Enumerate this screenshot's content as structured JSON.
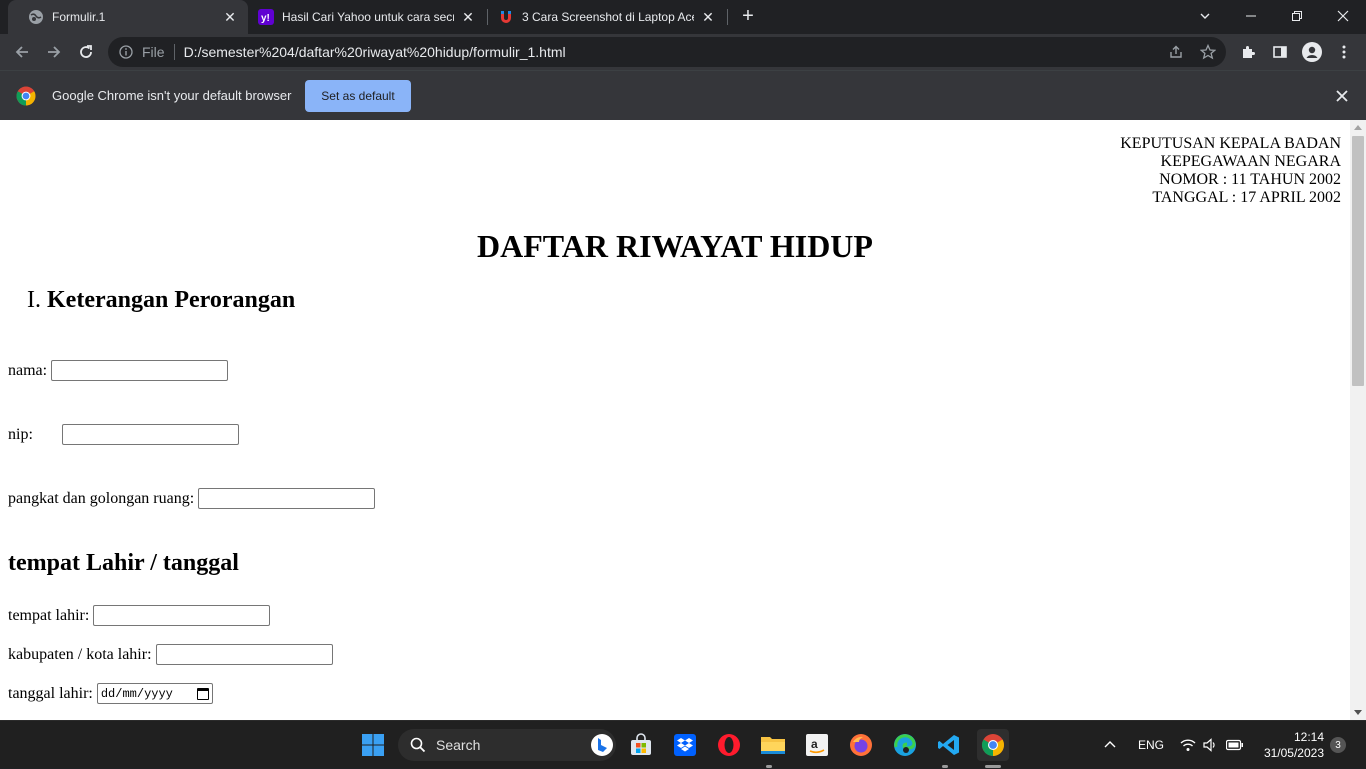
{
  "browser": {
    "tabs": [
      {
        "title": "Formulir.1",
        "active": true
      },
      {
        "title": "Hasil Cari Yahoo untuk cara secre",
        "active": false
      },
      {
        "title": "3 Cara Screenshot di Laptop Acer",
        "active": false
      }
    ],
    "address": {
      "scheme_label": "File",
      "url": "D:/semester%204/daftar%20riwayat%20hidup/formulir_1.html"
    },
    "infobar": {
      "message": "Google Chrome isn't your default browser",
      "button": "Set as default"
    }
  },
  "page": {
    "decree_lines": [
      "KEPUTUSAN KEPALA BADAN",
      "KEPEGAWAAN NEGARA",
      "NOMOR : 11 TAHUN 2002",
      "TANGGAL : 17 APRIL 2002"
    ],
    "title": "DAFTAR RIWAYAT HIDUP",
    "section_number": "I.",
    "section_title": "Keterangan Perorangan",
    "fields": {
      "nama": {
        "label": "nama:",
        "value": ""
      },
      "nip": {
        "label": "nip:",
        "value": ""
      },
      "pangkat": {
        "label": "pangkat dan golongan ruang:",
        "value": ""
      }
    },
    "subsection_title": "tempat Lahir / tanggal",
    "fields2": {
      "tempat_lahir": {
        "label": "tempat lahir:",
        "value": ""
      },
      "kabupaten": {
        "label": "kabupaten / kota lahir:",
        "value": ""
      },
      "tanggal_lahir": {
        "label": "tanggal lahir:",
        "placeholder": "dd/mm/yyyy"
      }
    }
  },
  "taskbar": {
    "search_label": "Search",
    "language": "ENG",
    "time": "12:14",
    "date": "31/05/2023",
    "notification_count": "3"
  },
  "colors": {
    "chrome_dark": "#202124",
    "chrome_toolbar": "#35363a",
    "button_blue": "#8ab4f8",
    "yahoo_purple": "#6001d2"
  }
}
